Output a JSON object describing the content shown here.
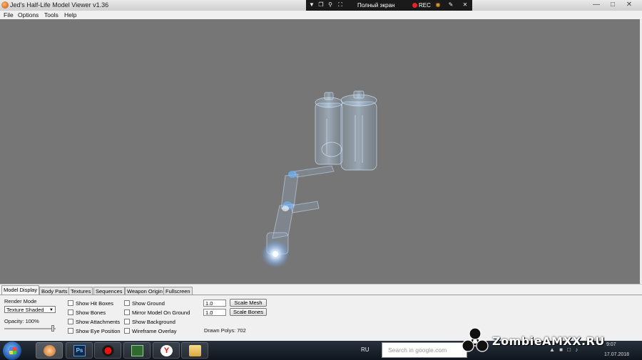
{
  "window": {
    "title": "Jed's Half-Life Model Viewer v1.36",
    "controls": [
      "minimize-icon",
      "maximize-icon",
      "close-icon"
    ]
  },
  "recorder": {
    "fullscreen_label": "Полный экран",
    "rec_label": "REC",
    "rec_color": "#e22222"
  },
  "menu": {
    "items": [
      "File",
      "Options",
      "Tools",
      "Help"
    ]
  },
  "viewport": {
    "background": "#767676",
    "model": "weapon-model"
  },
  "tabs": [
    {
      "label": "Model Display",
      "active": true
    },
    {
      "label": "Body Parts",
      "active": false
    },
    {
      "label": "Textures",
      "active": false
    },
    {
      "label": "Sequences",
      "active": false
    },
    {
      "label": "Weapon Origin",
      "active": false
    },
    {
      "label": "Fullscreen",
      "active": false
    }
  ],
  "model_display": {
    "render_mode_label": "Render Mode",
    "render_mode_value": "Texture Shaded",
    "opacity_label": "Opacity: 100%",
    "opacity_value": 1.0,
    "checkboxes_col1": [
      "Show Hit Boxes",
      "Show Bones",
      "Show Attachments",
      "Show Eye Position"
    ],
    "checkboxes_col2": [
      "Show Ground",
      "Mirror Model On Ground",
      "Show Background",
      "Wireframe Overlay"
    ],
    "scale_mesh_value": "1.0",
    "scale_mesh_button": "Scale Mesh",
    "scale_bones_value": "1.0",
    "scale_bones_button": "Scale Bones",
    "drawn_polys": "Drawn Polys: 702"
  },
  "taskbar": {
    "apps": [
      "hlmv-icon",
      "photoshop-icon",
      "recorder-icon",
      "cmd-icon",
      "yandex-browser-icon",
      "folder-icon"
    ],
    "ps_label": "Ps",
    "lang": "RU",
    "search_placeholder": "Search in google.com",
    "time": "9:07",
    "date": "17.07.2018"
  },
  "watermark": {
    "text": "ZombieAMXX.RU"
  }
}
